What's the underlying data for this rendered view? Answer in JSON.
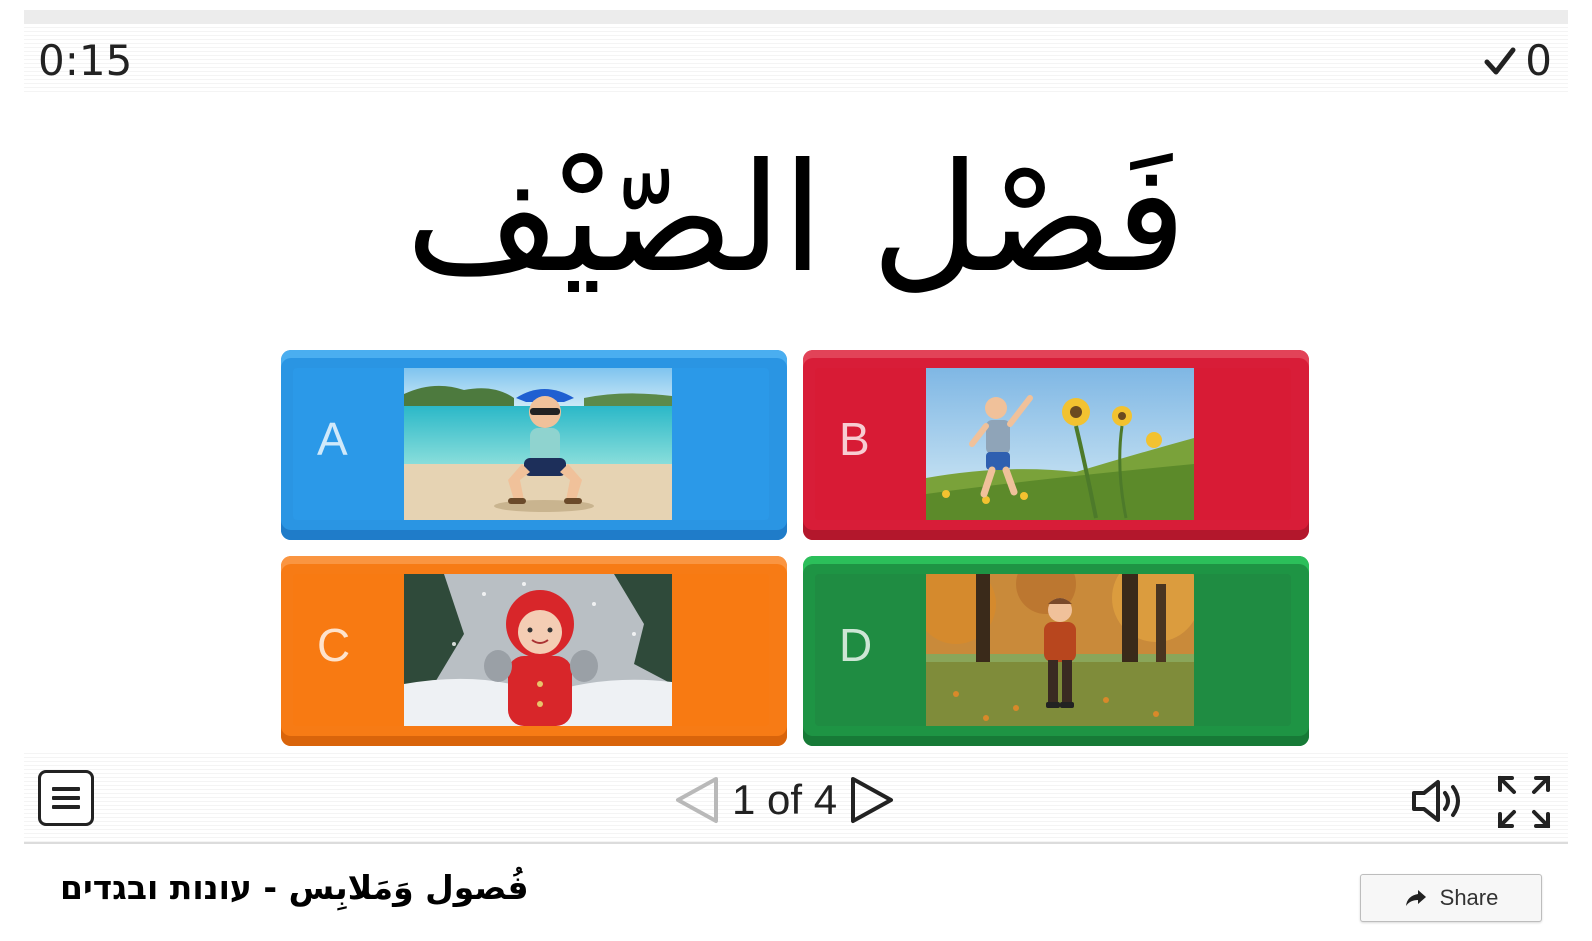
{
  "header": {
    "timer": "0:15",
    "score": "0",
    "score_icon": "checkmark-icon"
  },
  "question": {
    "text": "فَصْل الصّيْف"
  },
  "answers": [
    {
      "letter": "A",
      "color": "#2a95e3",
      "image": "child-on-beach-photo"
    },
    {
      "letter": "B",
      "color": "#d81d38",
      "image": "child-in-flower-meadow-photo"
    },
    {
      "letter": "C",
      "color": "#f77b15",
      "image": "child-in-snow-photo"
    },
    {
      "letter": "D",
      "color": "#1e9444",
      "image": "child-in-autumn-park-photo"
    }
  ],
  "controls": {
    "menu_icon": "menu-icon",
    "prev_icon": "arrow-left-icon",
    "next_icon": "arrow-right-icon",
    "page_text": "1 of 4",
    "sound_icon": "speaker-icon",
    "fullscreen_icon": "fullscreen-icon"
  },
  "footer": {
    "title": "فُصول وَمَلابِس - עונות ובגדים",
    "share_label": "Share",
    "share_icon": "share-arrow-icon"
  }
}
